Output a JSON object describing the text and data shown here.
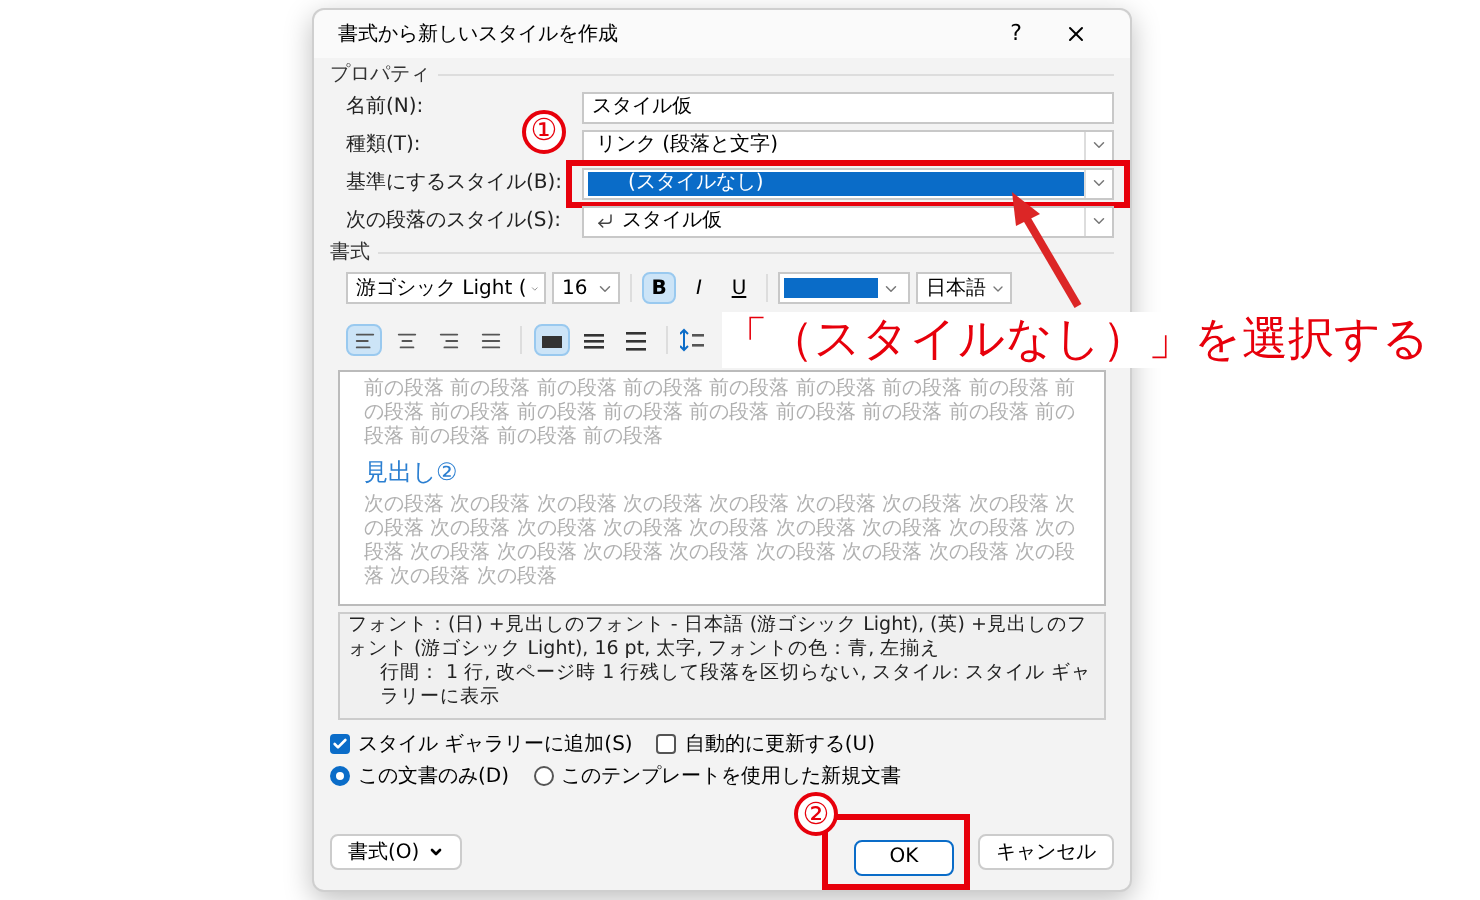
{
  "dialog": {
    "title": "書式から新しいスタイルを作成",
    "help": "?"
  },
  "properties": {
    "heading": "プロパティ",
    "fields": [
      {
        "label": "名前(N):",
        "kind": "text",
        "value": "スタイル仮"
      },
      {
        "label": "種類(T):",
        "kind": "dropdown",
        "value": "リンク (段落と文字)"
      },
      {
        "label": "基準にするスタイル(B):",
        "kind": "dropdown",
        "value": "(スタイルなし)",
        "highlighted": true
      },
      {
        "label": "次の段落のスタイル(S):",
        "kind": "paragraph-dropdown",
        "value": "スタイル仮"
      }
    ]
  },
  "format": {
    "heading": "書式",
    "font": "游ゴシック Light (",
    "size": "16",
    "styles": [
      {
        "label": "B",
        "selected": true
      },
      {
        "label": "I",
        "selected": false
      },
      {
        "label": "U",
        "selected": false
      }
    ],
    "language": "日本語",
    "alignment": [
      {
        "kind": "left",
        "selected": true
      },
      {
        "kind": "center",
        "selected": false
      },
      {
        "kind": "right",
        "selected": false
      },
      {
        "kind": "justify",
        "selected": false
      }
    ],
    "spacing": [
      {
        "kind": "single",
        "selected": true
      },
      {
        "kind": "onehalf",
        "selected": false
      },
      {
        "kind": "double",
        "selected": false
      }
    ]
  },
  "preview": {
    "previous_text": "前の段落 前の段落 前の段落 前の段落 前の段落 前の段落 前の段落 前の段落 前の段落 前の段落 前の段落 前の段落 前の段落 前の段落 前の段落 前の段落 前の段落 前の段落 前の段落 前の段落",
    "heading": "見出し②",
    "next_text": "次の段落 次の段落 次の段落 次の段落 次の段落 次の段落 次の段落 次の段落 次の段落 次の段落 次の段落 次の段落 次の段落 次の段落 次の段落 次の段落 次の段落 次の段落 次の段落 次の段落 次の段落 次の段落 次の段落 次の段落 次の段落 次の段落 次の段落"
  },
  "description": [
    "フォント：(日) +見出しのフォント - 日本語 (游ゴシック Light), (英) +見出しのフォント (游ゴシック Light), 16 pt, 太字, フォントの色：青, 左揃え",
    "行間： 1 行, 改ページ時 1 行残して段落を区切らない, スタイル: スタイル ギャラリーに表示"
  ],
  "checkboxes": [
    {
      "label": "スタイル ギャラリーに追加(S)",
      "checked": true
    },
    {
      "label": "自動的に更新する(U)",
      "checked": false
    }
  ],
  "radios": [
    {
      "label": "この文書のみ(D)",
      "selected": true
    },
    {
      "label": "このテンプレートを使用した新規文書",
      "selected": false
    }
  ],
  "buttons": {
    "format": "書式(O)",
    "ok": "OK",
    "cancel": "キャンセル"
  },
  "annotations": {
    "callouts": [
      "①",
      "②"
    ],
    "caption": "「（スタイルなし）」を選択する"
  }
}
